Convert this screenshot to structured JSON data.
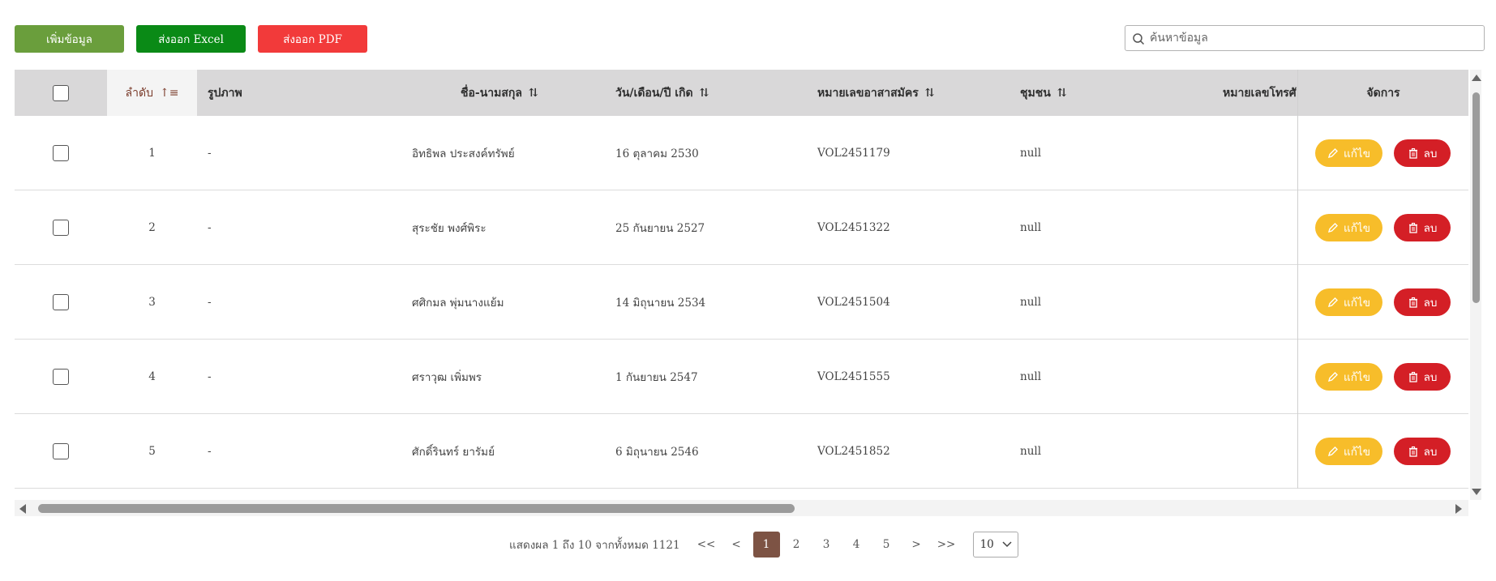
{
  "toolbar": {
    "add_label": "เพิ่มข้อมูล",
    "excel_label": "ส่งออก Excel",
    "pdf_label": "ส่งออก PDF"
  },
  "search": {
    "placeholder": "ค้นหาข้อมูล",
    "value": ""
  },
  "columns": {
    "order": "ลำดับ",
    "image": "รูปภาพ",
    "name": "ชื่อ-นามสกุล",
    "dob": "วัน/เดือน/ปี เกิด",
    "volunteer_id": "หมายเลขอาสาสมัคร",
    "community": "ชุมชน",
    "phone": "หมายเลขโทรศั",
    "actions": "จัดการ"
  },
  "rows": [
    {
      "no": "1",
      "image": "-",
      "name": "อิทธิพล ประสงค์ทรัพย์",
      "dob": "16 ตุลาคม 2530",
      "volunteer_id": "VOL2451179",
      "community": "null"
    },
    {
      "no": "2",
      "image": "-",
      "name": "สุระชัย พงศ์พิระ",
      "dob": "25 กันยายน 2527",
      "volunteer_id": "VOL2451322",
      "community": "null"
    },
    {
      "no": "3",
      "image": "-",
      "name": "ศศิกมล พุ่มนางแย้ม",
      "dob": "14 มิถุนายน 2534",
      "volunteer_id": "VOL2451504",
      "community": "null"
    },
    {
      "no": "4",
      "image": "-",
      "name": "ศราวุฒ เพิ่มพร",
      "dob": "1 กันยายน 2547",
      "volunteer_id": "VOL2451555",
      "community": "null"
    },
    {
      "no": "5",
      "image": "-",
      "name": "ศักดิ์รินทร์ ยารัมย์",
      "dob": "6 มิถุนายน 2546",
      "volunteer_id": "VOL2451852",
      "community": "null"
    }
  ],
  "row_actions": {
    "edit_label": "แก้ไข",
    "delete_label": "ลบ"
  },
  "pagination": {
    "info": "แสดงผล 1 ถึง 10 จากทั้งหมด 1121",
    "first": "<<",
    "prev": "<",
    "pages": [
      "1",
      "2",
      "3",
      "4",
      "5"
    ],
    "current": "1",
    "next": ">",
    "last": ">>",
    "rows_per_page": "10"
  },
  "colors": {
    "add": "#6a9e3c",
    "excel": "#0a8a16",
    "pdf": "#f23a3a",
    "edit": "#f7bd2a",
    "delete": "#d41f26",
    "active_page": "#7d5344",
    "header_bg": "#d9d8d9"
  },
  "icons": {
    "search": "search-icon",
    "sort": "sort-icon",
    "sort_active": "sort-ascending-icon",
    "edit": "pencil-icon",
    "delete": "trash-icon",
    "select": "chevron-down-icon"
  }
}
